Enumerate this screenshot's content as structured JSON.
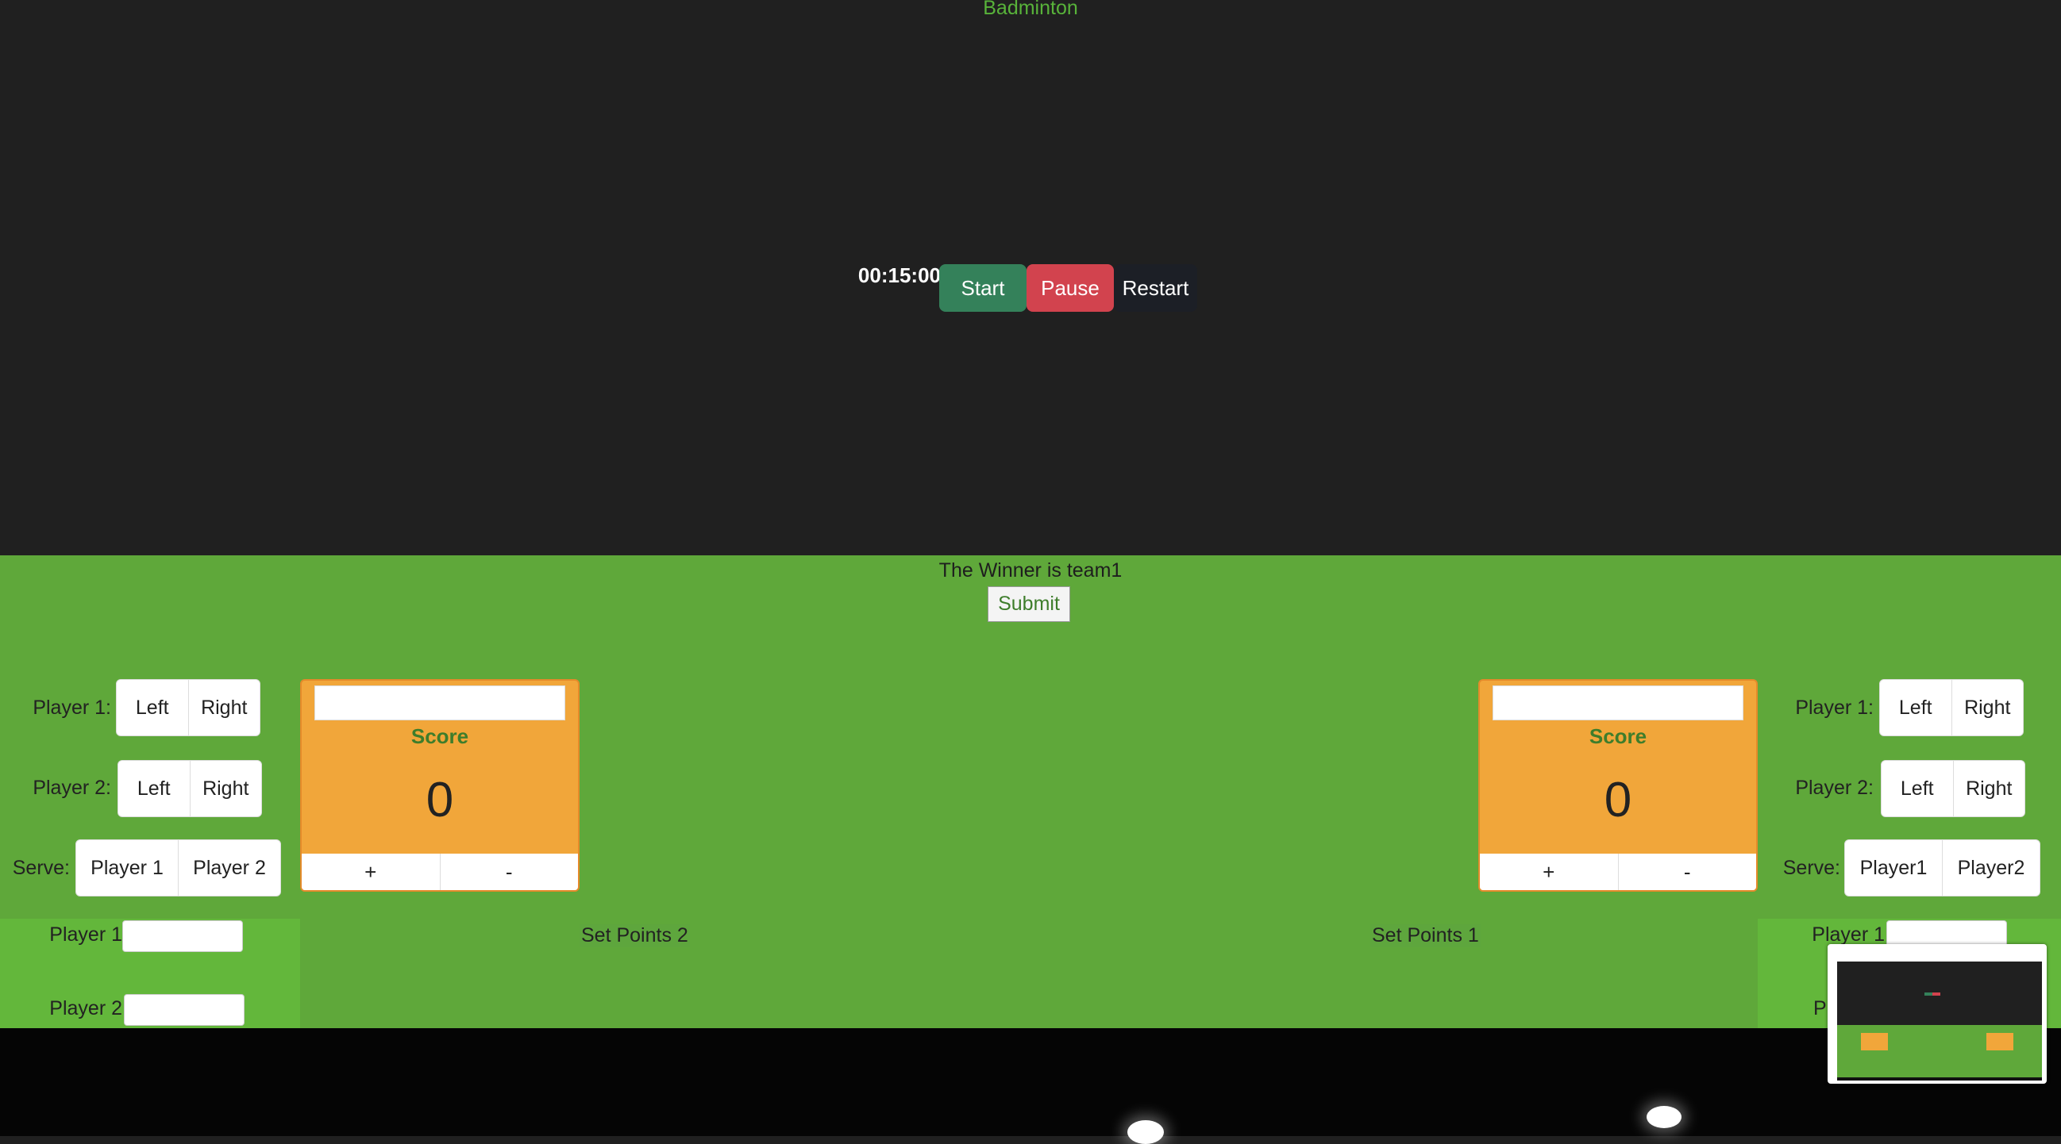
{
  "header": {
    "title": "Badminton"
  },
  "timer": {
    "value": "00:15:00",
    "start_label": "Start",
    "pause_label": "Pause",
    "restart_label": "Restart"
  },
  "result": {
    "winner_text": "The Winner is team1",
    "submit_label": "Submit"
  },
  "left_side": {
    "player1_label": "Player 1:",
    "player2_label": "Player 2:",
    "serve_label": "Serve:",
    "left_label": "Left",
    "right_label": "Right",
    "serve_p1": "Player 1",
    "serve_p2": "Player 2",
    "score_label": "Score",
    "score_value": "0",
    "plus": "+",
    "minus": "-",
    "bottom_p1": "Player 1",
    "bottom_p2": "Player 2",
    "set_points": "Set Points 2"
  },
  "right_side": {
    "player1_label": "Player 1:",
    "player2_label": "Player 2:",
    "serve_label": "Serve:",
    "left_label": "Left",
    "right_label": "Right",
    "serve_p1": "Player1",
    "serve_p2": "Player2",
    "score_label": "Score",
    "score_value": "0",
    "plus": "+",
    "minus": "-",
    "bottom_p1": "Player 1",
    "bottom_p2_partial": "Pl",
    "set_points": "Set Points 1"
  },
  "colors": {
    "bg_dark": "#202020",
    "green": "#5fa83a",
    "orange": "#f1a63a",
    "start": "#34815a",
    "pause": "#d2434e",
    "restart": "#1c1f26"
  }
}
